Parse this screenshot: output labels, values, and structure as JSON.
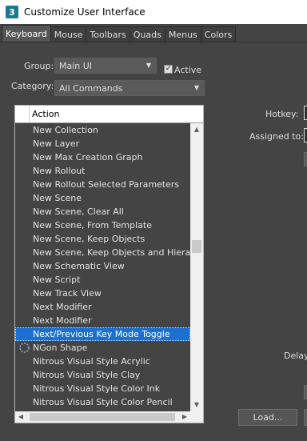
{
  "window": {
    "app_icon_text": "3",
    "title": "Customize User Interface"
  },
  "tabs": [
    {
      "label": "Keyboard",
      "active": true
    },
    {
      "label": "Mouse",
      "active": false
    },
    {
      "label": "Toolbars",
      "active": false
    },
    {
      "label": "Quads",
      "active": false
    },
    {
      "label": "Menus",
      "active": false
    },
    {
      "label": "Colors",
      "active": false
    }
  ],
  "filters": {
    "group_label": "Group:",
    "group_value": "Main UI",
    "active_label": "Active",
    "active_checked": true,
    "category_label": "Category:",
    "category_value": "All Commands"
  },
  "action_list": {
    "header": "Action",
    "rows": [
      {
        "label": "New Collection"
      },
      {
        "label": "New Layer"
      },
      {
        "label": "New Max Creation Graph"
      },
      {
        "label": "New Rollout"
      },
      {
        "label": "New Rollout Selected Parameters"
      },
      {
        "label": "New Scene"
      },
      {
        "label": "New Scene, Clear All"
      },
      {
        "label": "New Scene, From Template"
      },
      {
        "label": "New Scene, Keep Objects"
      },
      {
        "label": "New Scene, Keep Objects and Hierar"
      },
      {
        "label": "New Schematic View"
      },
      {
        "label": "New Script"
      },
      {
        "label": "New Track View"
      },
      {
        "label": "Next Modifier"
      },
      {
        "label": "Next Modifier"
      },
      {
        "label": "Next/Previous Key Mode Toggle",
        "selected": true
      },
      {
        "label": "NGon Shape",
        "icon": "ngon-shape-icon"
      },
      {
        "label": "Nitrous Visual Style Acrylic"
      },
      {
        "label": "Nitrous Visual Style Clay"
      },
      {
        "label": "Nitrous Visual Style Color Ink"
      },
      {
        "label": "Nitrous Visual Style Color Pencil"
      }
    ]
  },
  "right_panel": {
    "hotkey_label": "Hotkey:",
    "assigned_to_label": "Assigned to:",
    "delay_label": "Delay",
    "load_button": "Load..."
  },
  "colors": {
    "background": "#444444",
    "selection": "#1b6fd1",
    "title_bar": "#ffffff"
  }
}
